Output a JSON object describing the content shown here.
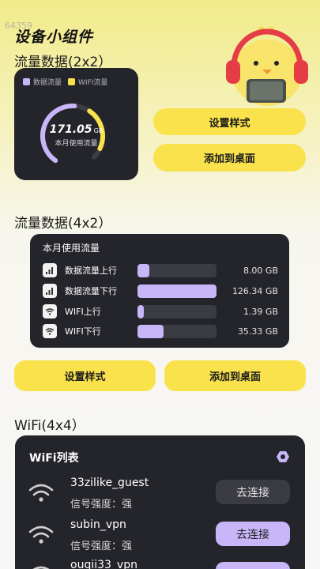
{
  "watermark": "64359",
  "page_title": "设备小组件",
  "colors": {
    "accent_yellow": "#f9e24b",
    "accent_purple": "#c8b6f9",
    "card_dark": "#24242b"
  },
  "widget_2x2": {
    "section_title": "流量数据(2x2）",
    "legend": [
      {
        "label": "数据流量",
        "color": "#c8b6f9"
      },
      {
        "label": "WIFI流量",
        "color": "#f9e24b"
      }
    ],
    "total_value": "171.05",
    "total_unit": "GB",
    "caption": "本月使用流量",
    "ring_share_data": 0.55,
    "ring_share_wifi": 0.3,
    "buttons": {
      "style": "设置样式",
      "add": "添加到桌面"
    }
  },
  "widget_4x2": {
    "section_title": "流量数据(4x2）",
    "title": "本月使用流量",
    "rows": [
      {
        "label": "数据流量上行",
        "value": "8.00 GB",
        "fill": 0.15,
        "icon": "cellular-signal-icon"
      },
      {
        "label": "数据流量下行",
        "value": "126.34 GB",
        "fill": 1.0,
        "icon": "cellular-signal-icon"
      },
      {
        "label": "WIFI上行",
        "value": "1.39 GB",
        "fill": 0.08,
        "icon": "wifi-icon"
      },
      {
        "label": "WIFI下行",
        "value": "35.33 GB",
        "fill": 0.33,
        "icon": "wifi-icon"
      }
    ],
    "buttons": {
      "style": "设置样式",
      "add": "添加到桌面"
    }
  },
  "widget_4x4": {
    "section_title": "WiFi(4x4）",
    "title": "WiFi列表",
    "items": [
      {
        "name": "33zilike_guest",
        "strength": "信号强度：强",
        "button": "去连接",
        "highlight": false
      },
      {
        "name": "subin_vpn",
        "strength": "信号强度：强",
        "button": "去连接",
        "highlight": true
      },
      {
        "name": "ouqii33_vpn",
        "strength": "",
        "button": "",
        "highlight": true
      }
    ]
  }
}
